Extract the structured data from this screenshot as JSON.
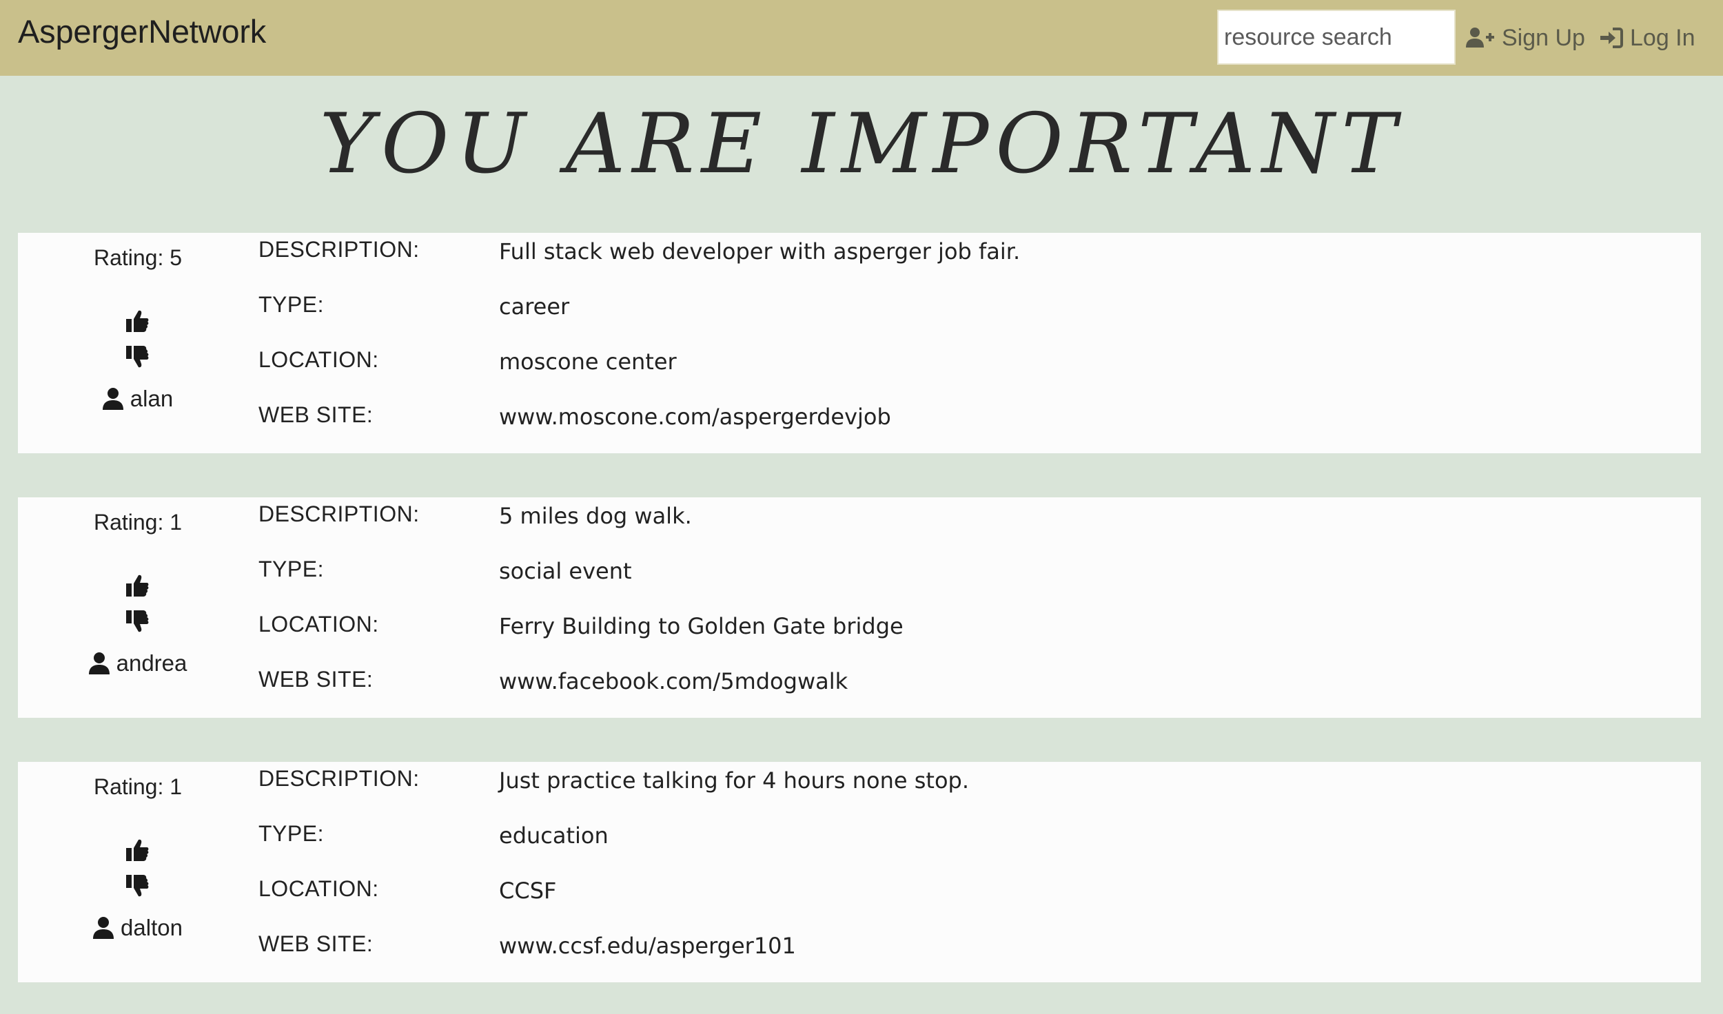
{
  "nav": {
    "brand": "AspergerNetwork",
    "search_placeholder": "resource search",
    "signup_label": "Sign Up",
    "login_label": "Log In",
    "bar_color": "#c9c08b"
  },
  "hero": {
    "title": "YOU ARE IMPORTANT"
  },
  "labels": {
    "description": "DESCRIPTION:",
    "type": "TYPE:",
    "location": "LOCATION:",
    "website": "WEB SITE:"
  },
  "resources": [
    {
      "rating": "Rating: 5",
      "user": "alan",
      "description": "Full stack web developer with asperger job fair.",
      "type": "career",
      "location": "moscone center",
      "website": "www.moscone.com/aspergerdevjob"
    },
    {
      "rating": "Rating: 1",
      "user": "andrea",
      "description": "5 miles dog walk.",
      "type": "social event",
      "location": "Ferry Building to Golden Gate bridge",
      "website": "www.facebook.com/5mdogwalk"
    },
    {
      "rating": "Rating: 1",
      "user": "dalton",
      "description": "Just practice talking for 4 hours none stop.",
      "type": "education",
      "location": "CCSF",
      "website": "www.ccsf.edu/asperger101"
    }
  ],
  "icons": {
    "signup": "user-plus-icon",
    "login": "sign-in-icon",
    "upvote": "thumbs-up-icon",
    "downvote": "thumbs-down-icon",
    "user": "user-icon"
  }
}
